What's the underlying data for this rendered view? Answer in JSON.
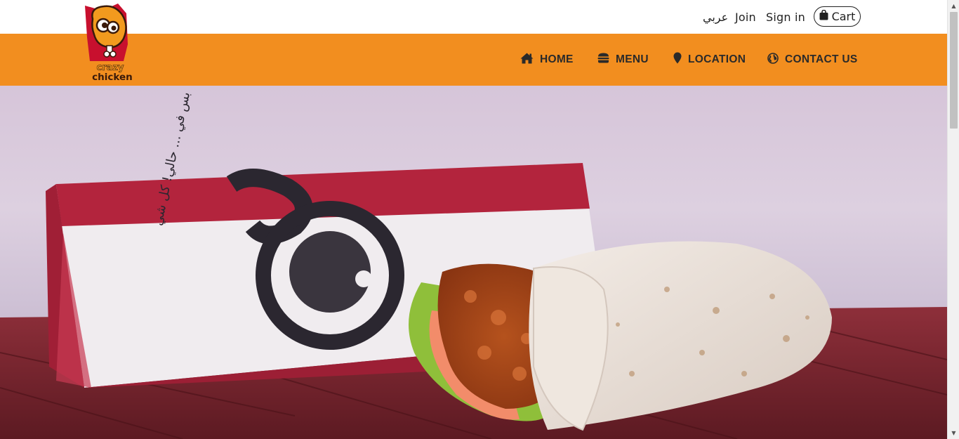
{
  "brand": {
    "logo_text_line1": "crazy",
    "logo_text_line2": "chicken",
    "colors": {
      "nav_bg": "#f28e1f",
      "logo_red": "#c8102e",
      "text_dark": "#2a2a2a"
    }
  },
  "topbar": {
    "language_link": "عربي",
    "join_link": "Join",
    "signin_link": "Sign in",
    "cart_label": "Cart",
    "cart_icon": "shopping-bag-icon"
  },
  "nav": {
    "items": [
      {
        "label": "HOME",
        "icon": "home-icon"
      },
      {
        "label": "MENU",
        "icon": "burger-icon"
      },
      {
        "label": "LOCATION",
        "icon": "map-pin-icon"
      },
      {
        "label": "CONTACT US",
        "icon": "globe-icon"
      }
    ]
  },
  "hero": {
    "image": "chicken-wrap-with-box-photo",
    "box_text": "بس في ... حالي! كل شي"
  }
}
